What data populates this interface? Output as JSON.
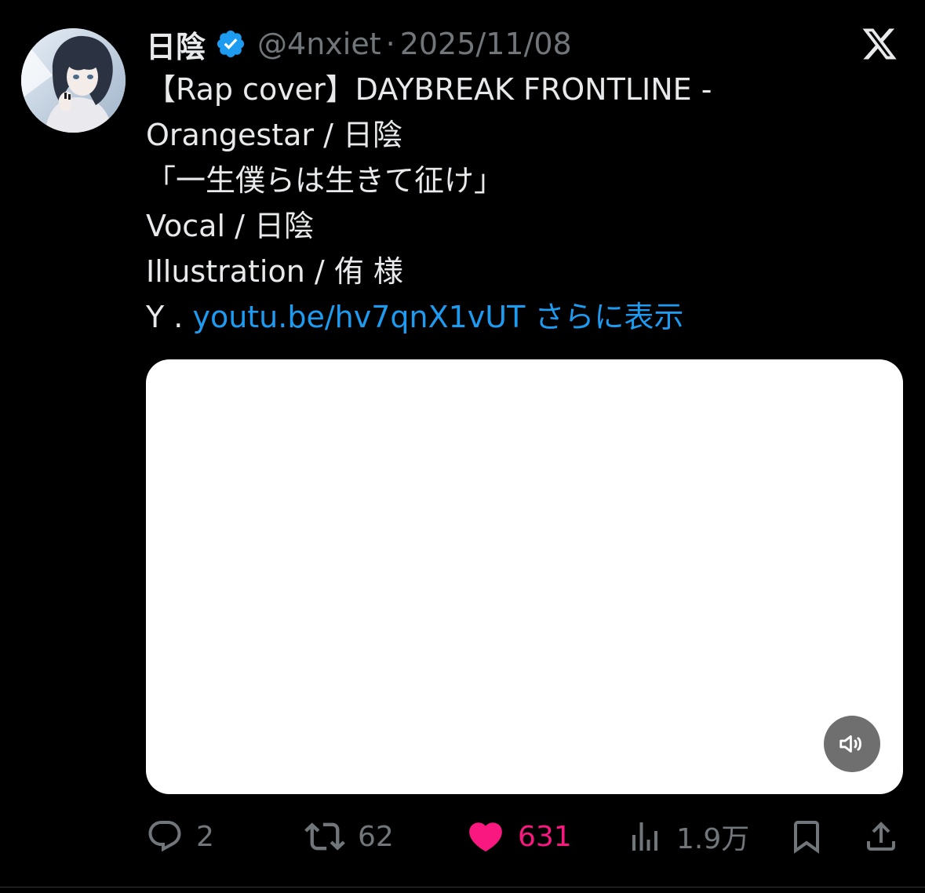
{
  "author": {
    "display_name": "日陰",
    "handle": "@4nxiet",
    "separator": "·",
    "timestamp": "2025/11/08",
    "verified": true,
    "avatar_icon": "avatar-illustration"
  },
  "brand": {
    "logo_icon": "x-logo-icon"
  },
  "tweet": {
    "lines": [
      "【Rap cover】DAYBREAK FRONTLINE -",
      "Orangestar  / 日陰",
      "「一生僕らは生きて征け」",
      "Vocal / 日陰",
      "Illustration / 侑 様"
    ],
    "last_line_prefix": "Y . ",
    "link_text": "youtu.be/hv7qnX1vUT",
    "show_more": "さらに表示"
  },
  "media": {
    "type": "video",
    "sound_icon": "speaker-icon"
  },
  "actions": {
    "reply": {
      "icon": "reply-icon",
      "count": "2"
    },
    "retweet": {
      "icon": "retweet-icon",
      "count": "62"
    },
    "like": {
      "icon": "heart-icon",
      "count": "631",
      "active": true
    },
    "views": {
      "icon": "analytics-icon",
      "count": "1.9万"
    },
    "bookmark": {
      "icon": "bookmark-icon"
    },
    "share": {
      "icon": "share-icon"
    }
  },
  "colors": {
    "background": "#000000",
    "text": "#e7e9ea",
    "muted": "#71767b",
    "link": "#1d9bf0",
    "like": "#f91880",
    "verified": "#1d9bf0"
  }
}
